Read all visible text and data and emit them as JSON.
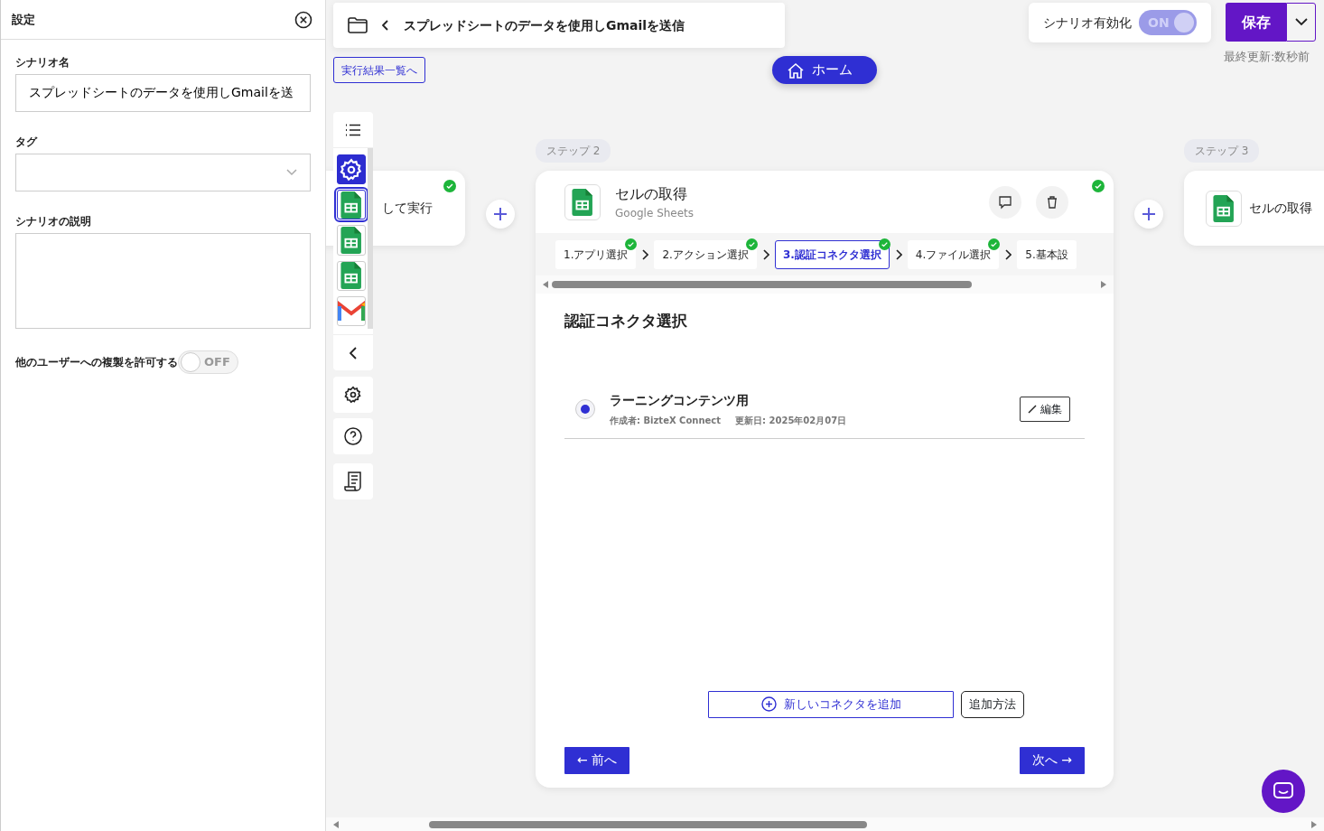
{
  "settings_panel": {
    "title": "設定",
    "name_label": "シナリオ名",
    "name_value": "スプレッドシートのデータを使用しGmailを送",
    "tag_label": "タグ",
    "description_label": "シナリオの説明",
    "allow_copy": {
      "label": "他のユーザーへの複製を許可する",
      "on": false,
      "text": "OFF"
    }
  },
  "header": {
    "breadcrumb": "スプレッドシートのデータを使用しGmailを送信",
    "results_link": "実行結果一覧へ",
    "home_button": "ホーム"
  },
  "activation": {
    "label": "シナリオ有効化",
    "on": true,
    "text": "ON"
  },
  "save": {
    "label": "保存",
    "last_updated": "最終更新:数秒前"
  },
  "toolbar": {
    "apps": [
      {
        "kind": "settings",
        "selected": false
      },
      {
        "kind": "sheets",
        "selected": true
      },
      {
        "kind": "sheets",
        "selected": false
      },
      {
        "kind": "sheets",
        "selected": false
      },
      {
        "kind": "gmail",
        "selected": false
      }
    ]
  },
  "steps": [
    {
      "text": "して実行",
      "done": true
    },
    {
      "label": "ステップ 2",
      "title": "セルの取得",
      "subtitle": "Google Sheets",
      "done": true
    },
    {
      "label": "ステップ 3",
      "title": "セルの取得"
    }
  ],
  "wizard_tabs": [
    {
      "label": "1.アプリ選択",
      "done": true,
      "selected": false
    },
    {
      "label": "2.アクション選択",
      "done": true,
      "selected": false
    },
    {
      "label": "3.認証コネクタ選択",
      "done": true,
      "selected": true
    },
    {
      "label": "4.ファイル選択",
      "done": true,
      "selected": false
    },
    {
      "label": "5.基本設",
      "done": false,
      "selected": false
    }
  ],
  "section_title": "認証コネクタ選択",
  "connectors": [
    {
      "name": "ラーニングコンテンツ用",
      "author": "作成者: BizteX Connect",
      "updated": "更新日: 2025年02月07日",
      "selected": true,
      "edit": "編集"
    }
  ],
  "add_connector": "新しいコネクタを追加",
  "how_to_add": "追加方法",
  "prev_button": "← 前へ",
  "next_button": "次へ →"
}
